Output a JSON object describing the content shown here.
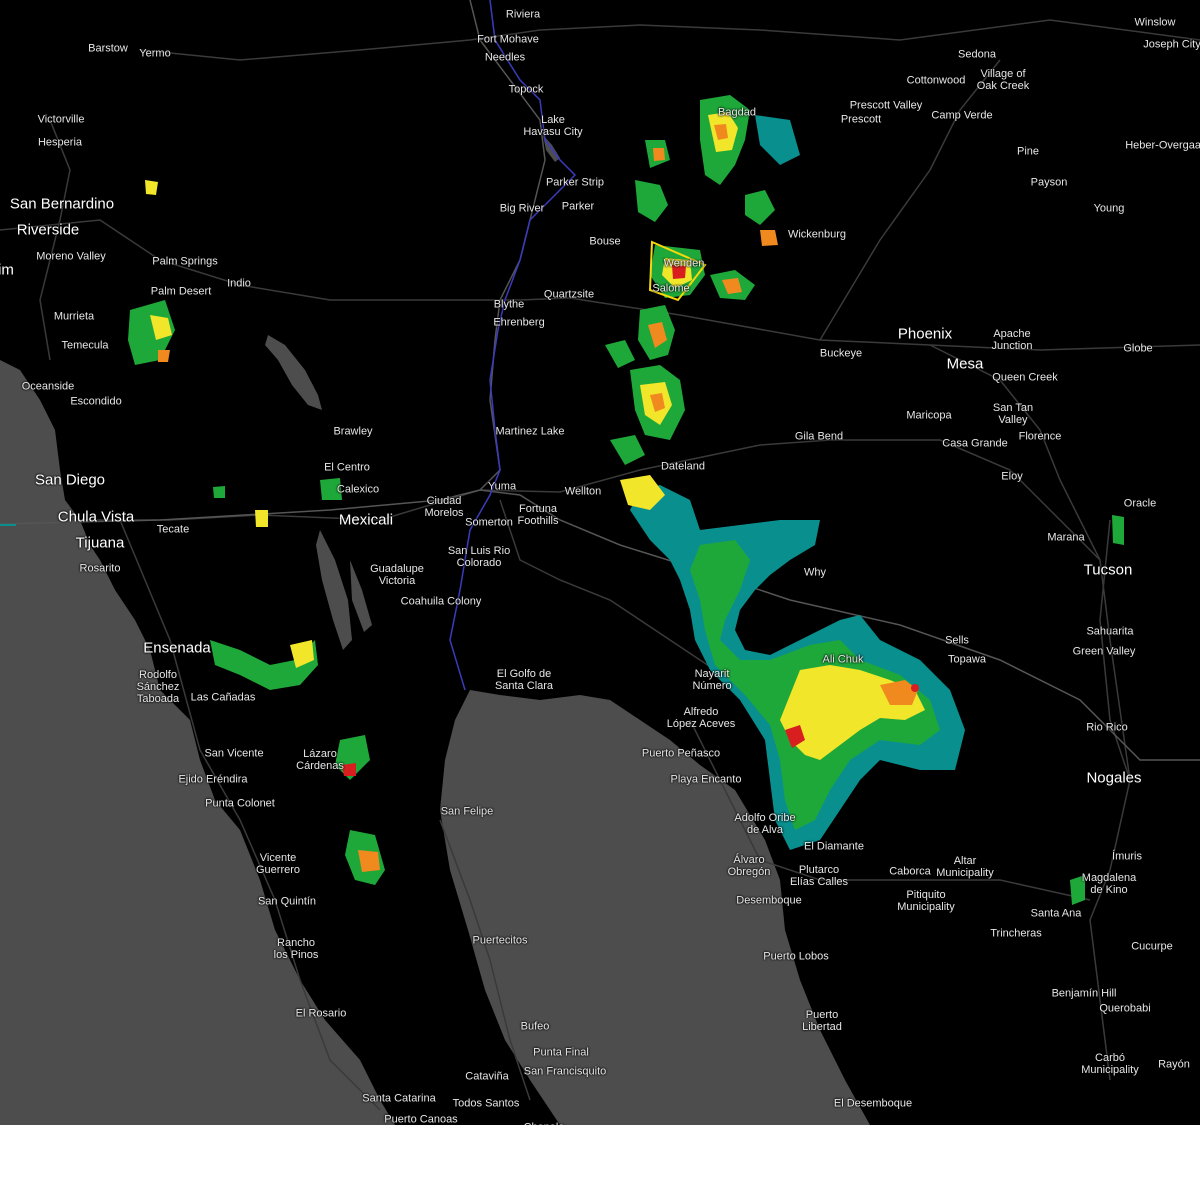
{
  "colors": {
    "land": "#000000",
    "water": "#4d4d4d",
    "road": "#3a3a3a",
    "border": "#555555",
    "river": "#3b3bbd",
    "radar_light": "#0a8f8f",
    "radar_green": "#1fa83a",
    "radar_yellow": "#f2e62a",
    "radar_orange": "#f08a1f",
    "radar_red": "#d81e1e",
    "warning_box": "#f5d90a"
  },
  "places": [
    {
      "name": "Riviera",
      "major": false
    },
    {
      "name": "Fort Mohave",
      "major": false
    },
    {
      "name": "Needles",
      "major": false
    },
    {
      "name": "Topock",
      "major": false
    },
    {
      "name": "Lake Havasu City",
      "major": false
    },
    {
      "name": "Parker Strip",
      "major": false
    },
    {
      "name": "Big River",
      "major": false
    },
    {
      "name": "Parker",
      "major": false
    },
    {
      "name": "Bouse",
      "major": false
    },
    {
      "name": "Quartzsite",
      "major": false
    },
    {
      "name": "Blythe",
      "major": false
    },
    {
      "name": "Ehrenberg",
      "major": false
    },
    {
      "name": "Salome",
      "major": false
    },
    {
      "name": "Wenden",
      "major": false
    },
    {
      "name": "Bagdad",
      "major": false
    },
    {
      "name": "Wickenburg",
      "major": false
    },
    {
      "name": "Prescott Valley",
      "major": false
    },
    {
      "name": "Prescott",
      "major": false
    },
    {
      "name": "Sedona",
      "major": false
    },
    {
      "name": "Village of Oak Creek",
      "major": false
    },
    {
      "name": "Cottonwood",
      "major": false
    },
    {
      "name": "Camp Verde",
      "major": false
    },
    {
      "name": "Winslow",
      "major": false
    },
    {
      "name": "Joseph City",
      "major": false
    },
    {
      "name": "Pine",
      "major": false
    },
    {
      "name": "Payson",
      "major": false
    },
    {
      "name": "Heber-Overgaard",
      "major": false
    },
    {
      "name": "Young",
      "major": false
    },
    {
      "name": "Phoenix",
      "major": true
    },
    {
      "name": "Mesa",
      "major": true
    },
    {
      "name": "Apache Junction",
      "major": false
    },
    {
      "name": "Globe",
      "major": false
    },
    {
      "name": "Buckeye",
      "major": false
    },
    {
      "name": "Queen Creek",
      "major": false
    },
    {
      "name": "San Tan Valley",
      "major": false
    },
    {
      "name": "Florence",
      "major": false
    },
    {
      "name": "Maricopa",
      "major": false
    },
    {
      "name": "Casa Grande",
      "major": false
    },
    {
      "name": "Eloy",
      "major": false
    },
    {
      "name": "Gila Bend",
      "major": false
    },
    {
      "name": "Dateland",
      "major": false
    },
    {
      "name": "Wellton",
      "major": false
    },
    {
      "name": "Martinez Lake",
      "major": false
    },
    {
      "name": "Yuma",
      "major": false
    },
    {
      "name": "Fortuna Foothills",
      "major": false
    },
    {
      "name": "Somerton",
      "major": false
    },
    {
      "name": "Ciudad Morelos",
      "major": false
    },
    {
      "name": "San Luis Rio Colorado",
      "major": false
    },
    {
      "name": "Why",
      "major": false
    },
    {
      "name": "Oracle",
      "major": false
    },
    {
      "name": "Marana",
      "major": false
    },
    {
      "name": "Tucson",
      "major": true
    },
    {
      "name": "Sells",
      "major": false
    },
    {
      "name": "Topawa",
      "major": false
    },
    {
      "name": "Sahuarita",
      "major": false
    },
    {
      "name": "Green Valley",
      "major": false
    },
    {
      "name": "Rio Rico",
      "major": false
    },
    {
      "name": "Nogales",
      "major": true
    },
    {
      "name": "Ali Chuk",
      "major": false
    },
    {
      "name": "Nayarit Número",
      "major": false
    },
    {
      "name": "Alfredo López Aceves",
      "major": false
    },
    {
      "name": "Puerto Peñasco",
      "major": false
    },
    {
      "name": "Playa Encanto",
      "major": false
    },
    {
      "name": "Adolfo Oribe de Alva",
      "major": false
    },
    {
      "name": "Álvaro Obregón",
      "major": false
    },
    {
      "name": "El Diamante",
      "major": false
    },
    {
      "name": "Plutarco Elías Calles",
      "major": false
    },
    {
      "name": "Caborca",
      "major": false
    },
    {
      "name": "Pitiquito Municipality",
      "major": false
    },
    {
      "name": "Altar Municipality",
      "major": false
    },
    {
      "name": "Desemboque",
      "major": false
    },
    {
      "name": "Puerto Lobos",
      "major": false
    },
    {
      "name": "Puerto Libertad",
      "major": false
    },
    {
      "name": "El Desemboque",
      "major": false
    },
    {
      "name": "Ímuris",
      "major": false
    },
    {
      "name": "Magdalena de Kino",
      "major": false
    },
    {
      "name": "Santa Ana",
      "major": false
    },
    {
      "name": "Trincheras",
      "major": false
    },
    {
      "name": "Cucurpe",
      "major": false
    },
    {
      "name": "Benjamín Hill",
      "major": false
    },
    {
      "name": "Querobabi",
      "major": false
    },
    {
      "name": "Carbó Municipality",
      "major": false
    },
    {
      "name": "Rayón",
      "major": false
    },
    {
      "name": "El Golfo de Santa Clara",
      "major": false
    },
    {
      "name": "Coahuila Colony",
      "major": false
    },
    {
      "name": "Guadalupe Victoria",
      "major": false
    },
    {
      "name": "Mexicali",
      "major": true
    },
    {
      "name": "Calexico",
      "major": false
    },
    {
      "name": "El Centro",
      "major": false
    },
    {
      "name": "Brawley",
      "major": false
    },
    {
      "name": "Barstow",
      "major": false
    },
    {
      "name": "Yermo",
      "major": false
    },
    {
      "name": "Victorville",
      "major": false
    },
    {
      "name": "Hesperia",
      "major": false
    },
    {
      "name": "San Bernardino",
      "major": true
    },
    {
      "name": "Riverside",
      "major": true
    },
    {
      "name": "Moreno Valley",
      "major": false
    },
    {
      "name": "Palm Springs",
      "major": false
    },
    {
      "name": "Indio",
      "major": false
    },
    {
      "name": "Palm Desert",
      "major": false
    },
    {
      "name": "Murrieta",
      "major": false
    },
    {
      "name": "Temecula",
      "major": false
    },
    {
      "name": "Oceanside",
      "major": false
    },
    {
      "name": "Escondido",
      "major": false
    },
    {
      "name": "San Diego",
      "major": true
    },
    {
      "name": "Chula Vista",
      "major": true
    },
    {
      "name": "Tijuana",
      "major": true
    },
    {
      "name": "Tecate",
      "major": false
    },
    {
      "name": "Rosarito",
      "major": false
    },
    {
      "name": "Ensenada",
      "major": true
    },
    {
      "name": "Rodolfo Sánchez Taboada",
      "major": false
    },
    {
      "name": "Las Cañadas",
      "major": false
    },
    {
      "name": "San Vicente",
      "major": false
    },
    {
      "name": "Ejido Eréndira",
      "major": false
    },
    {
      "name": "Lázaro Cárdenas",
      "major": false
    },
    {
      "name": "Punta Colonet",
      "major": false
    },
    {
      "name": "San Felipe",
      "major": false
    },
    {
      "name": "Vicente Guerrero",
      "major": false
    },
    {
      "name": "San Quintín",
      "major": false
    },
    {
      "name": "Rancho los Pinos",
      "major": false
    },
    {
      "name": "Puertecitos",
      "major": false
    },
    {
      "name": "El Rosario",
      "major": false
    },
    {
      "name": "Bufeo",
      "major": false
    },
    {
      "name": "Punta Final",
      "major": false
    },
    {
      "name": "San Francisquito",
      "major": false
    },
    {
      "name": "Cataviña",
      "major": false
    },
    {
      "name": "Santa Catarina",
      "major": false
    },
    {
      "name": "Todos Santos",
      "major": false
    },
    {
      "name": "Puerto Canoas",
      "major": false
    },
    {
      "name": "Chapala",
      "major": false
    },
    {
      "name": "im",
      "major": true
    }
  ]
}
